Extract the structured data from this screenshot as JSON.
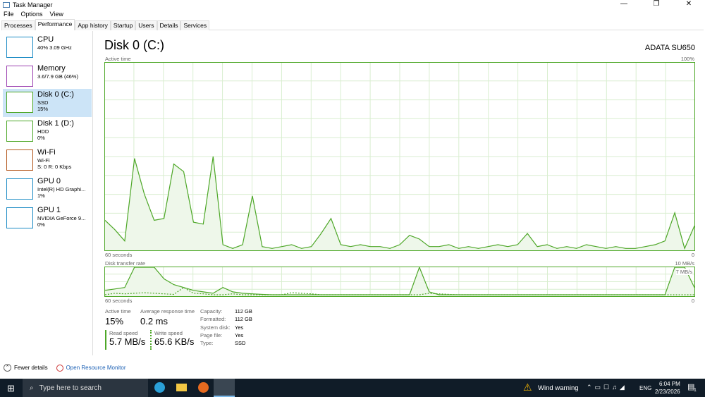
{
  "window": {
    "title": "Task Manager",
    "minimize": "—",
    "restore": "❐",
    "close": "✕"
  },
  "menu": [
    "File",
    "Options",
    "View"
  ],
  "tabs": [
    "Processes",
    "Performance",
    "App history",
    "Startup",
    "Users",
    "Details",
    "Services"
  ],
  "sidebar": [
    {
      "name": "CPU",
      "l1": "40% 3.09 GHz",
      "l2": "",
      "color": "#1b8bc4"
    },
    {
      "name": "Memory",
      "l1": "3.6/7.9 GB (46%)",
      "l2": "",
      "color": "#9b3fb0"
    },
    {
      "name": "Disk 0 (C:)",
      "l1": "SSD",
      "l2": "15%",
      "color": "#4da727"
    },
    {
      "name": "Disk 1 (D:)",
      "l1": "HDD",
      "l2": "0%",
      "color": "#4da727"
    },
    {
      "name": "Wi-Fi",
      "l1": "Wi-Fi",
      "l2": "S: 0 R: 0 Kbps",
      "color": "#b3561b"
    },
    {
      "name": "GPU 0",
      "l1": "Intel(R) HD Graphi...",
      "l2": "1%",
      "color": "#1b8bc4"
    },
    {
      "name": "GPU 1",
      "l1": "NVIDIA GeForce 9...",
      "l2": "0%",
      "color": "#1b8bc4"
    }
  ],
  "main": {
    "title": "Disk 0 (C:)",
    "model": "ADATA SU650",
    "chart1": {
      "label": "Active time",
      "max": "100%",
      "xleft": "60 seconds",
      "xright": "0"
    },
    "chart2": {
      "label": "Disk transfer rate",
      "max": "10 MB/s",
      "inner": "7 MB/s",
      "xleft": "60 seconds",
      "xright": "0"
    },
    "stats": {
      "active_label": "Active time",
      "active": "15%",
      "resp_label": "Average response time",
      "resp": "0.2 ms",
      "read_label": "Read speed",
      "read": "5.7 MB/s",
      "write_label": "Write speed",
      "write": "65.6 KB/s"
    },
    "props": [
      [
        "Capacity:",
        "112 GB"
      ],
      [
        "Formatted:",
        "112 GB"
      ],
      [
        "System disk:",
        "Yes"
      ],
      [
        "Page file:",
        "Yes"
      ],
      [
        "Type:",
        "SSD"
      ]
    ]
  },
  "footer": {
    "fewer": "Fewer details",
    "monitor": "Open Resource Monitor"
  },
  "taskbar": {
    "search": "Type here to search",
    "weather": "Wind warning",
    "lang": "ENG",
    "time": "6:04 PM",
    "date": "2/23/2026",
    "notif": "1"
  },
  "colors": {
    "disk": "#4da727",
    "fill": "#eef7ea",
    "grid": "#d9eed0"
  },
  "chart_data": {
    "type": "area",
    "title": "Active time",
    "ylim": [
      0,
      100
    ],
    "values": [
      16,
      11,
      5,
      49,
      30,
      16,
      17,
      46,
      42,
      15,
      14,
      50,
      3,
      1,
      3,
      29,
      2,
      1,
      2,
      3,
      1,
      2,
      9,
      17,
      3,
      2,
      3,
      2,
      2,
      1,
      3,
      8,
      6,
      2,
      2,
      3,
      1,
      2,
      1,
      2,
      3,
      2,
      3,
      9,
      2,
      3,
      1,
      2,
      1,
      3,
      2,
      1,
      2,
      1,
      1,
      2,
      3,
      5,
      20,
      1,
      13
    ],
    "transfer_read": [
      20,
      25,
      30,
      100,
      100,
      100,
      60,
      40,
      30,
      20,
      15,
      10,
      30,
      15,
      10,
      8,
      6,
      5,
      5,
      5,
      5,
      5,
      5,
      5,
      5,
      5,
      5,
      5,
      5,
      5,
      5,
      5,
      100,
      15,
      5,
      5,
      5,
      5,
      5,
      5,
      5,
      5,
      5,
      5,
      5,
      5,
      5,
      5,
      5,
      5,
      5,
      5,
      5,
      5,
      5,
      5,
      5,
      5,
      100,
      100,
      30
    ],
    "transfer_write": [
      5,
      10,
      8,
      10,
      12,
      10,
      8,
      6,
      30,
      10,
      8,
      5,
      5,
      8,
      5,
      5,
      5,
      5,
      5,
      12,
      10,
      8,
      5,
      5,
      5,
      5,
      5,
      5,
      5,
      5,
      5,
      5,
      5,
      10,
      8,
      6,
      5,
      5,
      5,
      5,
      5,
      5,
      5,
      5,
      5,
      5,
      5,
      5,
      5,
      5,
      5,
      5,
      5,
      5,
      5,
      5,
      5,
      5,
      5,
      5,
      5
    ]
  }
}
